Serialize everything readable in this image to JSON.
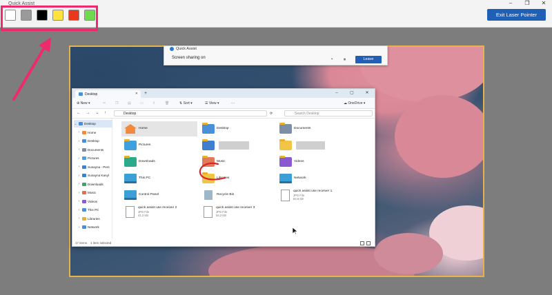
{
  "topbar": {
    "app_title": "Quick Assist",
    "exit_label": "Exit Laser Pointer",
    "swatches": [
      "#ffffff",
      "#9a9a9a",
      "#000000",
      "#ffe23d",
      "#e8391d",
      "#6fd94f"
    ],
    "highlight_color": "#ee2a6f"
  },
  "quick_assist": {
    "title": "Quick Assist",
    "status": "Screen sharing on",
    "leave_label": "Leave"
  },
  "explorer": {
    "tab_title": "Desktop",
    "toolbar": {
      "new": "New",
      "sort": "Sort",
      "view": "View",
      "more": "···",
      "onedrive": "OneDrive"
    },
    "address": "Desktop",
    "search_placeholder": "Search Desktop",
    "sidebar": [
      "Desktop",
      "Home",
      "Desktop",
      "Documents",
      "Pictures",
      "Sunayna - Pers",
      "Sunayna Kanyl",
      "Downloads",
      "Music",
      "Videos",
      "This PC",
      "Libraries",
      "Network"
    ],
    "items": [
      {
        "name": "Home",
        "sub": "",
        "sub2": ""
      },
      {
        "name": "Desktop",
        "sub": "",
        "sub2": ""
      },
      {
        "name": "Documents",
        "sub": "",
        "sub2": ""
      },
      {
        "name": "Pictures",
        "sub": "",
        "sub2": ""
      },
      {
        "name": "",
        "sub": "",
        "sub2": ""
      },
      {
        "name": "",
        "sub": "",
        "sub2": ""
      },
      {
        "name": "Downloads",
        "sub": "",
        "sub2": ""
      },
      {
        "name": "Music",
        "sub": "",
        "sub2": ""
      },
      {
        "name": "Videos",
        "sub": "",
        "sub2": ""
      },
      {
        "name": "This PC",
        "sub": "",
        "sub2": ""
      },
      {
        "name": "Libraries",
        "sub": "",
        "sub2": ""
      },
      {
        "name": "Network",
        "sub": "",
        "sub2": ""
      },
      {
        "name": "Control Panel",
        "sub": "",
        "sub2": ""
      },
      {
        "name": "Recycle Bin",
        "sub": "",
        "sub2": ""
      },
      {
        "name": "quick assist use receiver 1",
        "sub": "JPG File",
        "sub2": "84.6 KB"
      },
      {
        "name": "quick assist use receiver 2",
        "sub": "JPG File",
        "sub2": "41.2 KB"
      },
      {
        "name": "quick assist use receiver 3",
        "sub": "JPG File",
        "sub2": "54.2 KB"
      }
    ],
    "status": {
      "count": "17 items",
      "selected": "1 item selected"
    }
  }
}
